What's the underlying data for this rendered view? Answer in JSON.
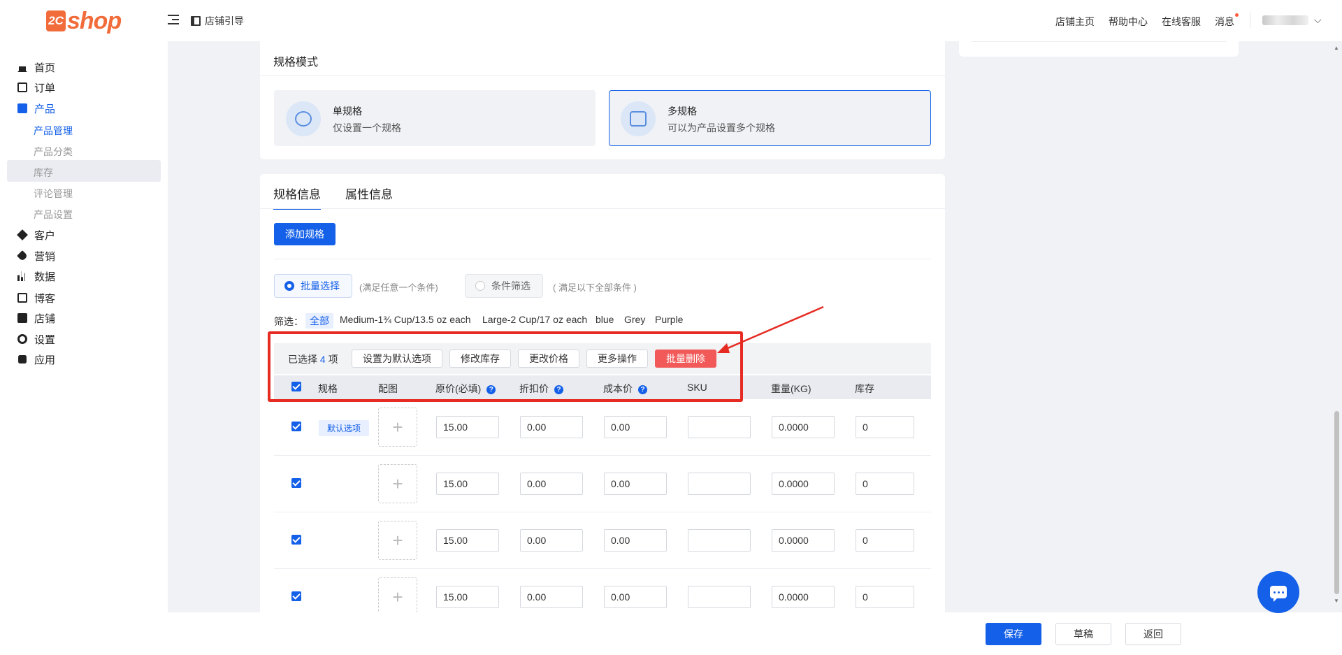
{
  "brand": {
    "badge": "2C",
    "name": "shop"
  },
  "header": {
    "guide": "店铺引导",
    "nav": [
      "店铺主页",
      "帮助中心",
      "在线客服",
      "消息"
    ],
    "user_chevron": "⌵"
  },
  "sidebar": {
    "items": [
      {
        "label": "首页",
        "icon": "home-icon"
      },
      {
        "label": "订单",
        "icon": "order-icon"
      },
      {
        "label": "产品",
        "icon": "product-bag-icon"
      },
      {
        "label": "客户",
        "icon": "customer-icon"
      },
      {
        "label": "营销",
        "icon": "tag-icon"
      },
      {
        "label": "数据",
        "icon": "chart-icon"
      },
      {
        "label": "博客",
        "icon": "blog-edit-icon"
      },
      {
        "label": "店铺",
        "icon": "store-icon"
      },
      {
        "label": "设置",
        "icon": "gear-icon"
      },
      {
        "label": "应用",
        "icon": "puzzle-icon"
      }
    ],
    "product_sub": [
      "产品管理",
      "产品分类",
      "库存",
      "评论管理",
      "产品设置"
    ]
  },
  "spec_mode": {
    "title": "规格模式",
    "single": {
      "name": "单规格",
      "desc": "仅设置一个规格"
    },
    "multi": {
      "name": "多规格",
      "desc": "可以为产品设置多个规格"
    }
  },
  "tabs": [
    "规格信息",
    "属性信息"
  ],
  "add_spec_label": "添加规格",
  "select_mode": {
    "batch_label": "批量选择",
    "batch_hint": "(满足任意一个条件)",
    "cond_label": "条件筛选",
    "cond_hint": "( 满足以下全部条件 )"
  },
  "filter": {
    "label": "筛选：",
    "chips": [
      "全部",
      "Medium-1¾ Cup/13.5 oz each",
      "Large-2 Cup/17 oz each",
      "blue",
      "Grey",
      "Purple"
    ]
  },
  "batch": {
    "selected_prefix": "已选择",
    "selected_count": "4",
    "selected_suffix": "项",
    "buttons": [
      "设置为默认选项",
      "修改库存",
      "更改价格",
      "更多操作"
    ],
    "delete_label": "批量删除"
  },
  "table": {
    "headers": [
      "规格",
      "配图",
      "原价(必填)",
      "折扣价",
      "成本价",
      "SKU",
      "重量(KG)",
      "库存"
    ],
    "default_tag": "默认选项",
    "rows": [
      {
        "checked": true,
        "default": true,
        "price": "15.00",
        "discount": "0.00",
        "cost": "0.00",
        "sku": "",
        "weight": "0.0000",
        "stock": "0"
      },
      {
        "checked": true,
        "default": false,
        "price": "15.00",
        "discount": "0.00",
        "cost": "0.00",
        "sku": "",
        "weight": "0.0000",
        "stock": "0"
      },
      {
        "checked": true,
        "default": false,
        "price": "15.00",
        "discount": "0.00",
        "cost": "0.00",
        "sku": "",
        "weight": "0.0000",
        "stock": "0"
      },
      {
        "checked": true,
        "default": false,
        "price": "15.00",
        "discount": "0.00",
        "cost": "0.00",
        "sku": "",
        "weight": "0.0000",
        "stock": "0"
      }
    ],
    "upload_glyph": "+"
  },
  "footer": {
    "save": "保存",
    "draft": "草稿",
    "back": "返回"
  },
  "colors": {
    "primary": "#1560e8",
    "danger": "#f25a5a",
    "annotation": "#e52b22",
    "brand": "#f26b3a"
  }
}
